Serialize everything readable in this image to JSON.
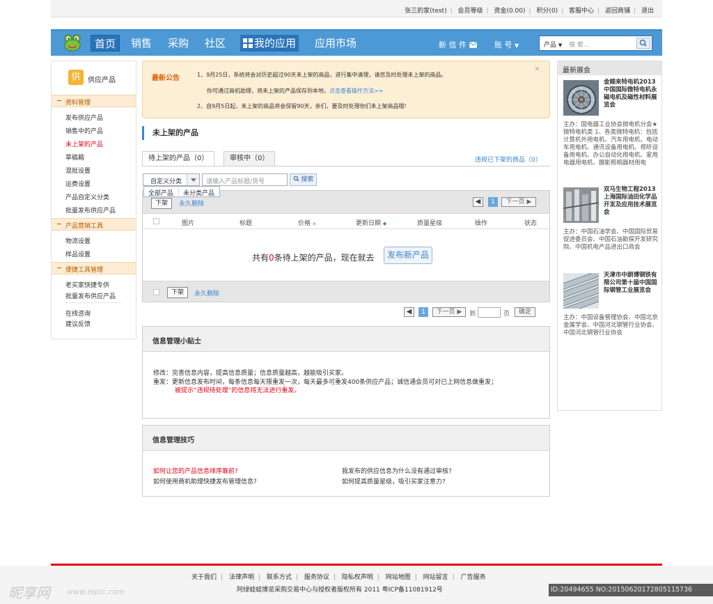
{
  "topbar": {
    "links": [
      "张三的家(test)",
      "会员等级",
      "资金(0.00)",
      "积分(0)",
      "客服中心",
      "返回商铺",
      "退出"
    ]
  },
  "nav": {
    "home": "首页",
    "sales": "销售",
    "purchase": "采购",
    "community": "社区",
    "my_apps": "我的应用",
    "app_market": "应用市场",
    "messages": "新 信 件",
    "account": "账 号",
    "search_category": "产品",
    "search_placeholder": "搜 索..."
  },
  "sidebar": {
    "title_icon": "供",
    "title": "供应产品",
    "sections": [
      {
        "title": "资料管理",
        "items": [
          "发布供应产品",
          "销售中的产品",
          "未上架的产品",
          "草稿箱",
          "混批设置",
          "运费设置",
          "产品自定义分类",
          "批量发布供应产品"
        ]
      },
      {
        "title": "产品营销工具",
        "items": [
          "物流设置",
          "样品设置"
        ]
      },
      {
        "title": "便捷工具管理",
        "items": [
          "老买家快捷专供",
          "批量发布供应产品"
        ]
      }
    ],
    "extra": [
      "在线咨询",
      "建议反馈"
    ]
  },
  "notice": {
    "label": "最新公告",
    "line1": "1、9月25日，系统将会对历史超过90天未上架的商品，进行集中清理，请您及时处理未上架的商品。",
    "line2_prefix": "你可通过商机助理，将未上架的产品保存到本地，",
    "line2_link": "点击查看操作方法>>",
    "line3": "2、自9月5日起，未上架的商品将会保留90天，亲们，要及时处理你们未上架商品哦!",
    "close": "×"
  },
  "main": {
    "title": "未上架的产品",
    "tab_pending": "待上架的产品（0）",
    "tab_review": "审核中（0）",
    "tab_violation": "违规已下架的商品（0）",
    "category_select": "自定义分类",
    "keyword_placeholder": "请输入产品标题/货号",
    "search_button": "搜索",
    "dropdown_all": "全部产品",
    "dropdown_uncat": "未分类产品",
    "btn_unlist": "下架",
    "btn_delete": "永久删除",
    "page_current": "1",
    "page_prev": "◀",
    "page_next": "下一页 ▶",
    "columns": [
      "图片",
      "标题",
      "价格",
      "更新日期",
      "质量星级",
      "操作",
      "状态"
    ],
    "empty_prefix": "共有",
    "empty_count": "0",
    "empty_suffix": "条待上架的产品，现在就去",
    "publish_button": "发布新产品",
    "goto_label": "到",
    "page_label": "页",
    "confirm_button": "确定"
  },
  "tips": {
    "title": "信息管理小贴士",
    "line1": "修改：完善信息内容，提高信息质量；信息质量越高，越能吸引买家。",
    "line2": "重发：更新信息发布时间，每条信息每天限重发一次，每天最多可重发400条供应产品；诚信通会员可对已上网信息做重发；",
    "line3": "被提示“违规待处理”的信息将无法进行重发。"
  },
  "skills": {
    "title": "信息管理技巧",
    "q1": "如何让您的产品信息排序靠前?",
    "q2": "如何使用商机助理快捷发布管理信息?",
    "q3": "我发布的供应信息为什么没有通过审核?",
    "q4": "如何提高质量星级，吸引买家注意力?"
  },
  "expos": {
    "title": "最新展会",
    "items": [
      {
        "title": "金顺来特电机2013中国国际微特电机永磁电机及磁性材料展览会",
        "desc": "主办：国电器工业协会微电机分会★微特电机类 1、各类微特电机：包括计算机外用电机、汽车用电机、电动车用电机、通讯设备用电机、视听设备用电机、办公自动化用电机、家用电器用电机、摄影照相器材用电"
      },
      {
        "title": "双马生物工程2013上海国际油田化学品开发及应用技术展览会",
        "desc": "主办：中国石油学会、中国国际贸易促进委员会、中国石油勘探开发研究院、中国机电产品进出口商会"
      },
      {
        "title": "天津市中朗博钢铁有限公司第十届中国国际钢管工业展览会",
        "desc": "主办：中国设备管理协会、中国北京金属学会、中国河北钢管行业协会、中国河北钢管行业协会"
      }
    ]
  },
  "footer": {
    "links": [
      "关于我们",
      "法律声明",
      "联系方式",
      "服务协议",
      "隐私权声明",
      "网站地图",
      "网站留言",
      "广告服务"
    ],
    "copyright": "阿绿蛙蛙博览采购交易中心与授权者版权所有 2011 粤ICP备11081912号"
  },
  "watermark": {
    "brand": "昵享网",
    "url": "www.nipic.com",
    "id": "ID:20494655 NO:20150620172805115736"
  },
  "colors": {
    "nav_bg": "#4d99d5",
    "accent_red": "#e60012",
    "link_blue": "#3a86d0",
    "notice_bg": "#fdefd6",
    "section_orange": "#b35a00"
  }
}
